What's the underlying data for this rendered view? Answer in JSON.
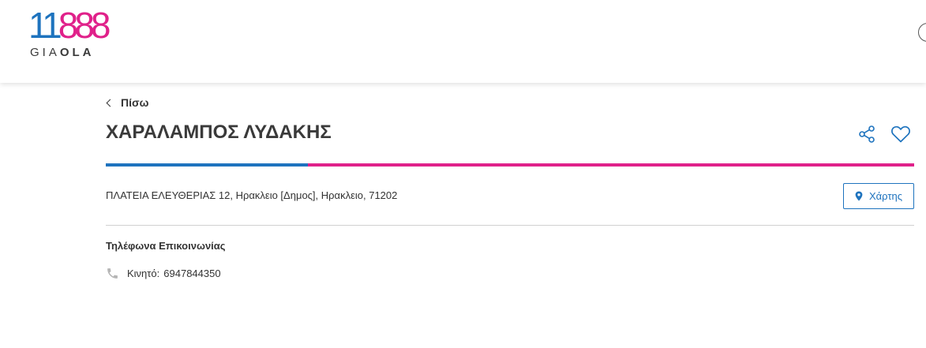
{
  "header": {
    "logo": {
      "number_part1": "11",
      "number_part2": "888",
      "sub_light": "GIA",
      "sub_bold": "OLA"
    },
    "colors": {
      "blue": "#1e73be",
      "pink": "#e0218a"
    }
  },
  "nav": {
    "back_label": "Πίσω"
  },
  "listing": {
    "name": "ΧΑΡΑΛΑΜΠΟΣ ΛΥΔΑΚΗΣ",
    "address": "ΠΛΑΤΕΙΑ ΕΛΕΥΘΕΡΙΑΣ 12, Ηρακλειο [Δημος], Ηρακλειο, 71202",
    "map_button_label": "Χάρτης",
    "contact_section_title": "Τηλέφωνα Επικοινωνίας",
    "phones": [
      {
        "label": "Κινητό:",
        "number": "6947844350"
      }
    ]
  },
  "icons": {
    "share": "share-icon",
    "favorite": "heart-icon",
    "map": "map-pin-icon",
    "phone": "phone-icon",
    "back": "chevron-left-icon",
    "user": "user-circle-icon"
  }
}
